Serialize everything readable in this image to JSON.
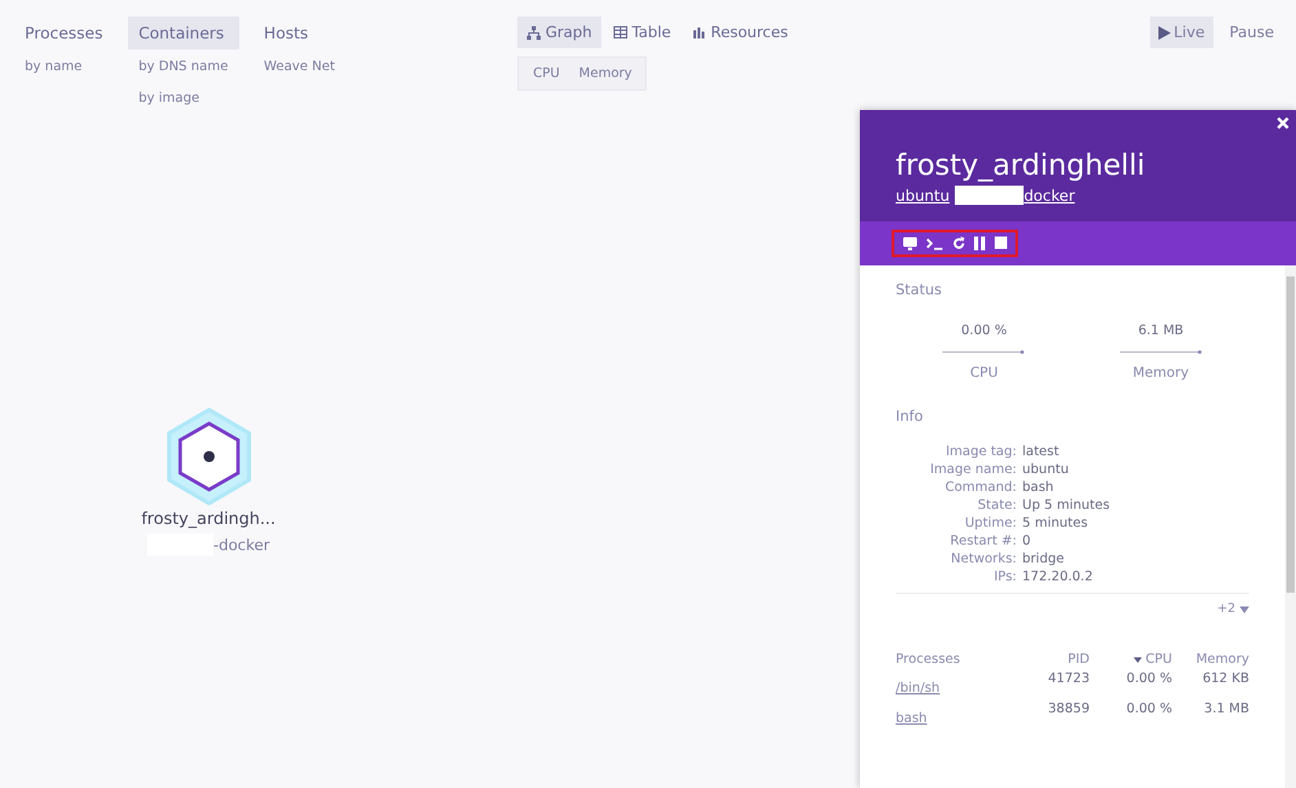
{
  "topology_menu": [
    {
      "label": "Processes",
      "selected": false,
      "options": [
        "by name"
      ]
    },
    {
      "label": "Containers",
      "selected": true,
      "options": [
        "by DNS name",
        "by image"
      ]
    },
    {
      "label": "Hosts",
      "selected": false,
      "options": [
        "Weave Net"
      ]
    }
  ],
  "view_tabs": [
    {
      "label": "Graph",
      "kind": "graph",
      "selected": true
    },
    {
      "label": "Table",
      "kind": "table",
      "selected": false
    },
    {
      "label": "Resources",
      "kind": "resources",
      "selected": false
    }
  ],
  "metric_selector": [
    "CPU",
    "Memory"
  ],
  "playback": [
    {
      "label": "Live",
      "selected": true
    },
    {
      "label": "Pause",
      "selected": false
    }
  ],
  "node": {
    "label": "frosty_ardingh...",
    "sublabel": "-docker"
  },
  "details": {
    "title": "frosty_ardinghelli",
    "links": [
      "ubuntu",
      "docker"
    ],
    "controls": {
      "highlighted": true,
      "buttons": [
        {
          "kind": "attach"
        },
        {
          "kind": "exec"
        },
        {
          "kind": "restart"
        },
        {
          "kind": "pause"
        },
        {
          "kind": "stop"
        }
      ]
    },
    "status": {
      "heading": "Status",
      "metrics": [
        {
          "value": "0.00 %",
          "label": "CPU"
        },
        {
          "value": "6.1 MB",
          "label": "Memory"
        }
      ]
    },
    "info": {
      "heading": "Info",
      "rows": [
        {
          "key": "Image tag:",
          "value": "latest"
        },
        {
          "key": "Image name:",
          "value": "ubuntu"
        },
        {
          "key": "Command:",
          "value": "bash"
        },
        {
          "key": "State:",
          "value": "Up 5 minutes"
        },
        {
          "key": "Uptime:",
          "value": "5 minutes"
        },
        {
          "key": "Restart #:",
          "value": "0"
        },
        {
          "key": "Networks:",
          "value": "bridge"
        },
        {
          "key": "IPs:",
          "value": "172.20.0.2"
        }
      ],
      "more": "+2"
    },
    "processes": {
      "columns": [
        "Processes",
        "PID",
        "CPU",
        "Memory"
      ],
      "rows": [
        [
          "/bin/sh",
          "41723",
          "0.00 %",
          "612 KB"
        ],
        [
          "bash",
          "38859",
          "0.00 %",
          "3.1 MB"
        ]
      ]
    }
  }
}
